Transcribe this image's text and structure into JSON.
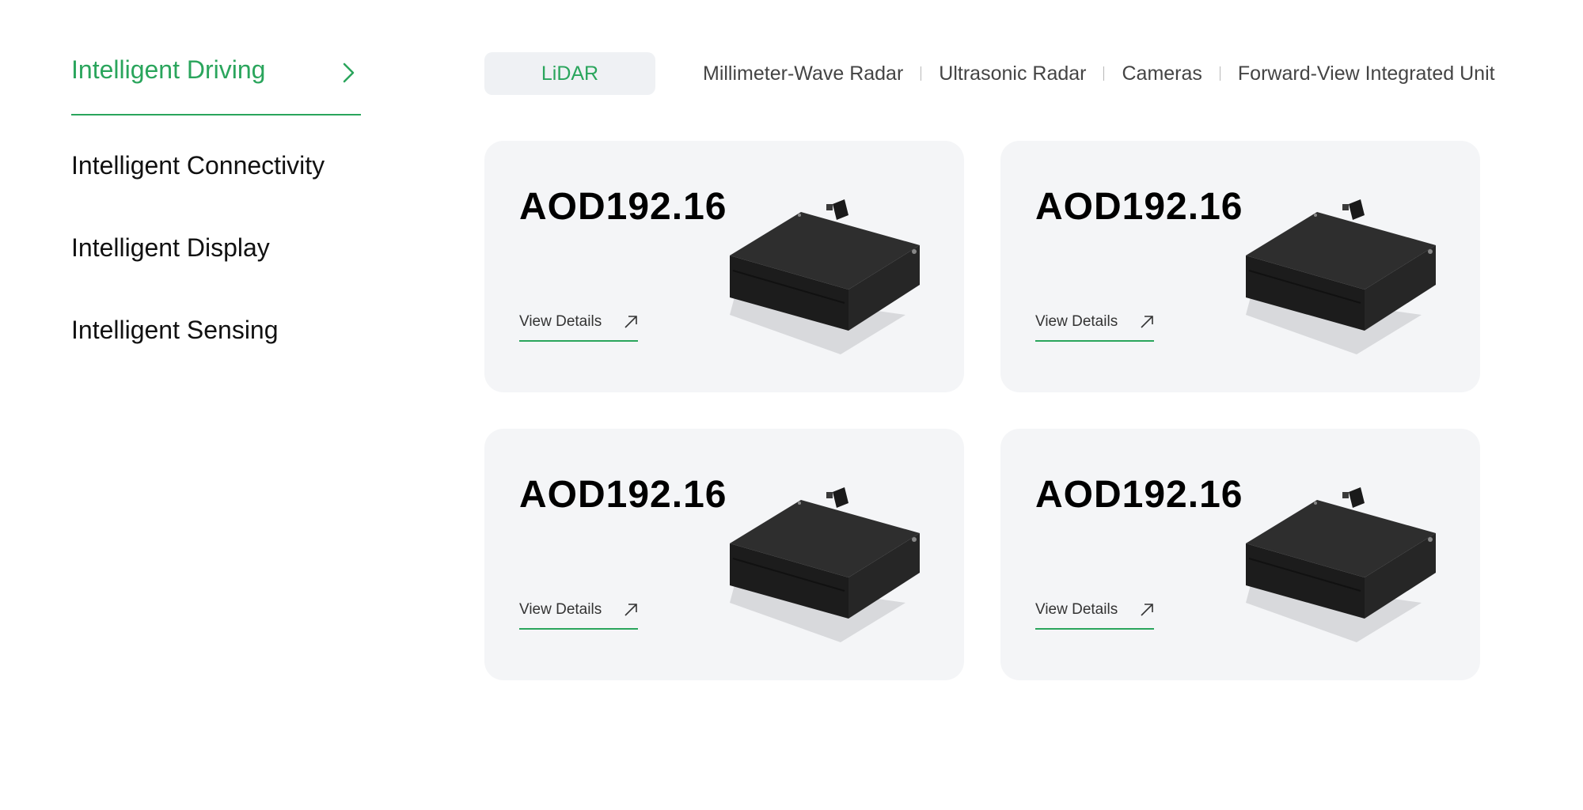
{
  "sidebar": {
    "items": [
      {
        "label": "Intelligent Driving",
        "active": true
      },
      {
        "label": "Intelligent Connectivity",
        "active": false
      },
      {
        "label": "Intelligent Display",
        "active": false
      },
      {
        "label": "Intelligent Sensing",
        "active": false
      }
    ]
  },
  "tabs": [
    {
      "label": "LiDAR",
      "active": true
    },
    {
      "label": "Millimeter-Wave Radar"
    },
    {
      "label": "Ultrasonic Radar"
    },
    {
      "label": "Cameras"
    },
    {
      "label": "Forward-View Integrated Unit"
    }
  ],
  "cards": [
    {
      "title": "AOD192.16",
      "link": "View Details"
    },
    {
      "title": "AOD192.16",
      "link": "View Details"
    },
    {
      "title": "AOD192.16",
      "link": "View Details"
    },
    {
      "title": "AOD192.16",
      "link": "View Details"
    }
  ],
  "colors": {
    "accent": "#2aa55c",
    "card_bg": "#f4f5f7",
    "tab_active_bg": "#eff1f4"
  },
  "icons": {
    "sidebar_active": "chevron-right-icon",
    "card_link": "arrow-up-right-icon",
    "card_image": "lidar-device-icon"
  }
}
